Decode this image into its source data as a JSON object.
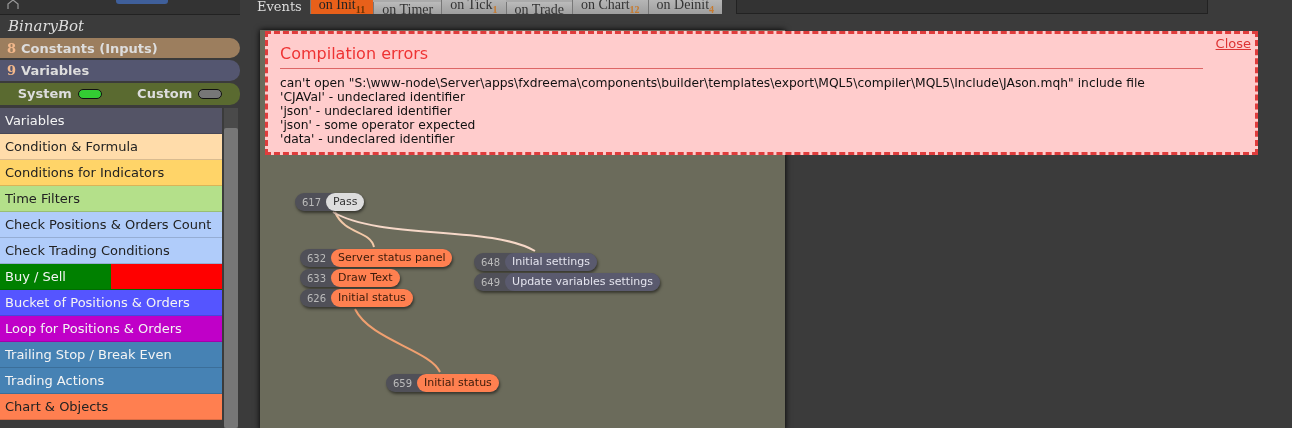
{
  "sidebar": {
    "title": "BinaryBot",
    "sections": [
      {
        "count": "8",
        "label": "Constants (Inputs)",
        "color": "#9c7e5e"
      },
      {
        "count": "9",
        "label": "Variables",
        "color": "#545670"
      }
    ],
    "toggles": [
      {
        "label": "System",
        "on": true
      },
      {
        "label": "Custom",
        "on": false
      }
    ],
    "items": [
      {
        "label": "Variables",
        "color": "#545466"
      },
      {
        "label": "Condition & Formula",
        "color": "#ffdcaa"
      },
      {
        "label": "Conditions for Indicators",
        "color": "#ffd468"
      },
      {
        "label": "Time Filters",
        "color": "#b4e08a"
      },
      {
        "label": "Check Positions & Orders Count",
        "color": "#b0ccfa"
      },
      {
        "label": "Check Trading Conditions",
        "color": "#b0ccfa"
      },
      {
        "label": "Buy / Sell",
        "color": "#008000",
        "sell_part": {
          "color": "#ff0000"
        }
      },
      {
        "label": "Bucket of Positions & Orders",
        "color": "#5555ff"
      },
      {
        "label": "Loop for Positions & Orders",
        "color": "#c000c8"
      },
      {
        "label": "Trailing Stop / Break Even",
        "color": "#4682b4"
      },
      {
        "label": "Trading Actions",
        "color": "#4682b4"
      },
      {
        "label": "Chart & Objects",
        "color": "#ff7f50"
      }
    ]
  },
  "events": {
    "label": "Events",
    "tabs": [
      {
        "label": "on Init",
        "count": "11",
        "selected": true
      },
      {
        "label": "on Timer",
        "selected": false
      },
      {
        "label": "on Tick",
        "count": "1",
        "selected": false
      },
      {
        "label": "on Trade",
        "selected": false
      },
      {
        "label": "on Chart",
        "count": "12",
        "selected": false
      },
      {
        "label": "on Deinit",
        "count": "4",
        "selected": false
      }
    ]
  },
  "error_panel": {
    "title": "Compilation errors",
    "close": "Close",
    "messages": [
      "can't open \"S:\\www-node\\Server\\apps\\fxdreema\\components\\builder\\templates\\export\\MQL5\\compiler\\MQL5\\Include\\JAson.mqh\" include file",
      "'CJAVal' - undeclared identifier",
      "'json' - undeclared identifier",
      "'json' - some operator expected",
      "'data' - undeclared identifier"
    ]
  },
  "blocks": [
    {
      "id": "617",
      "label": "Pass",
      "kind": "pass"
    },
    {
      "id": "632",
      "label": "Server status panel",
      "kind": "action"
    },
    {
      "id": "633",
      "label": "Draw Text",
      "kind": "action"
    },
    {
      "id": "626",
      "label": "Initial status",
      "kind": "action"
    },
    {
      "id": "648",
      "label": "Initial settings",
      "kind": "variable"
    },
    {
      "id": "649",
      "label": "Update variables settings",
      "kind": "variable"
    },
    {
      "id": "659",
      "label": "Initial status",
      "kind": "action"
    }
  ]
}
